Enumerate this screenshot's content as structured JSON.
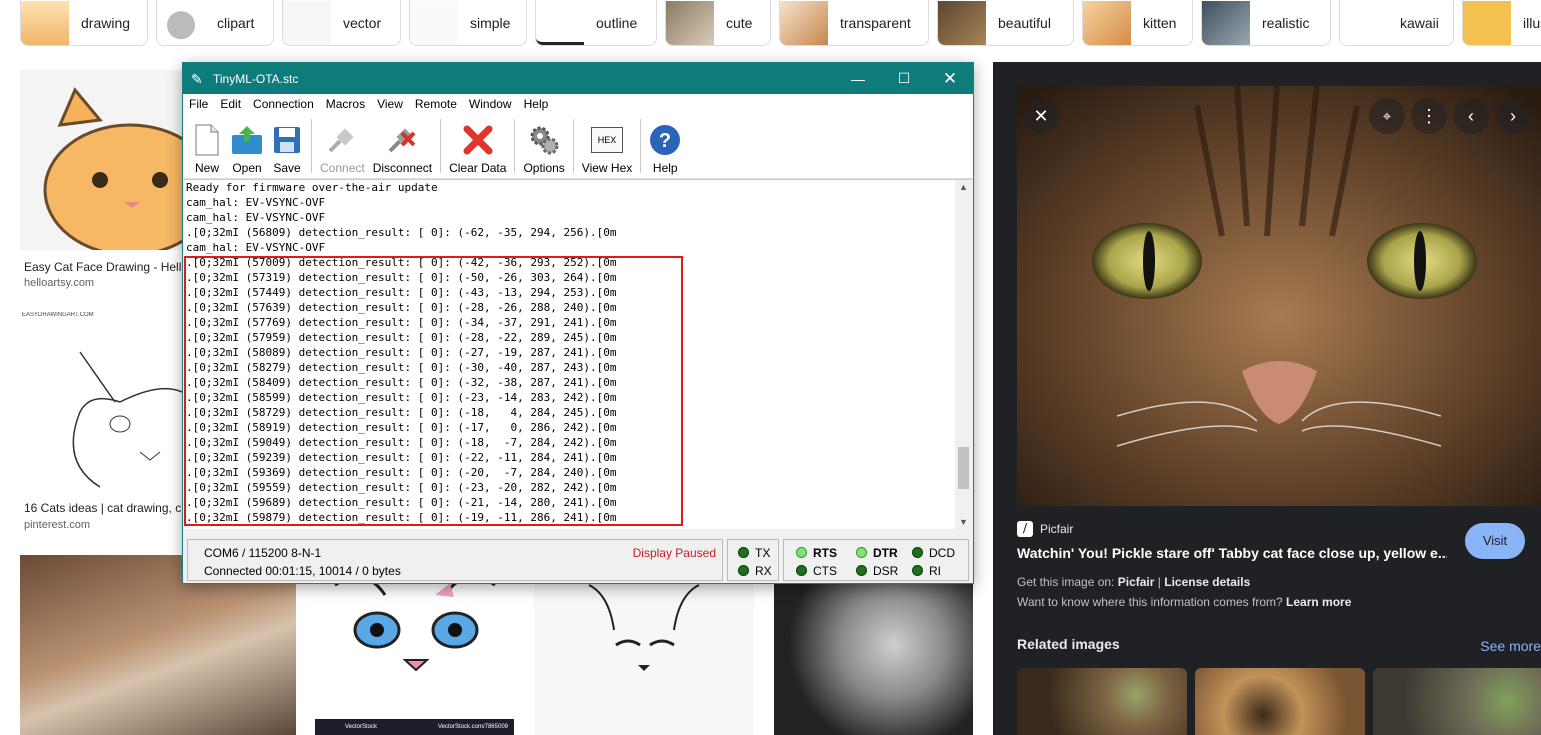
{
  "chips": [
    {
      "label": "drawing"
    },
    {
      "label": "clipart"
    },
    {
      "label": "vector"
    },
    {
      "label": "simple"
    },
    {
      "label": "outline"
    },
    {
      "label": "cute"
    },
    {
      "label": "transparent"
    },
    {
      "label": "beautiful"
    },
    {
      "label": "kitten"
    },
    {
      "label": "realistic"
    },
    {
      "label": "kawaii"
    },
    {
      "label": "illus"
    }
  ],
  "results": {
    "r1": {
      "title": "Easy Cat Face Drawing - Hell",
      "source": "helloartsy.com"
    },
    "r2": {
      "watermark": "EASYDRAWINGART.COM",
      "title": "16 Cats ideas | cat drawing, c",
      "source": "pinterest.com"
    },
    "r3_watermark": "VectorStock",
    "r3_watermark2": "VectorStock.com/7865009"
  },
  "window": {
    "title": "TinyML-OTA.stc",
    "menu": [
      "File",
      "Edit",
      "Connection",
      "Macros",
      "View",
      "Remote",
      "Window",
      "Help"
    ],
    "toolbar": {
      "new": "New",
      "open": "Open",
      "save": "Save",
      "connect": "Connect",
      "disconnect": "Disconnect",
      "clear": "Clear Data",
      "options": "Options",
      "viewhex": "View Hex",
      "hex_icon_text": "HEX",
      "help": "Help"
    },
    "terminal_lines": [
      "Ready for firmware over-the-air update",
      "cam_hal: EV-VSYNC-OVF",
      "cam_hal: EV-VSYNC-OVF",
      ".[0;32mI (56809) detection_result: [ 0]: (-62, -35, 294, 256).[0m",
      "cam_hal: EV-VSYNC-OVF",
      ".[0;32mI (57009) detection_result: [ 0]: (-42, -36, 293, 252).[0m",
      ".[0;32mI (57319) detection_result: [ 0]: (-50, -26, 303, 264).[0m",
      ".[0;32mI (57449) detection_result: [ 0]: (-43, -13, 294, 253).[0m",
      ".[0;32mI (57639) detection_result: [ 0]: (-28, -26, 288, 240).[0m",
      ".[0;32mI (57769) detection_result: [ 0]: (-34, -37, 291, 241).[0m",
      ".[0;32mI (57959) detection_result: [ 0]: (-28, -22, 289, 245).[0m",
      ".[0;32mI (58089) detection_result: [ 0]: (-27, -19, 287, 241).[0m",
      ".[0;32mI (58279) detection_result: [ 0]: (-30, -40, 287, 243).[0m",
      ".[0;32mI (58409) detection_result: [ 0]: (-32, -38, 287, 241).[0m",
      ".[0;32mI (58599) detection_result: [ 0]: (-23, -14, 283, 242).[0m",
      ".[0;32mI (58729) detection_result: [ 0]: (-18,   4, 284, 245).[0m",
      ".[0;32mI (58919) detection_result: [ 0]: (-17,   0, 286, 242).[0m",
      ".[0;32mI (59049) detection_result: [ 0]: (-18,  -7, 284, 242).[0m",
      ".[0;32mI (59239) detection_result: [ 0]: (-22, -11, 284, 241).[0m",
      ".[0;32mI (59369) detection_result: [ 0]: (-20,  -7, 284, 240).[0m",
      ".[0;32mI (59559) detection_result: [ 0]: (-23, -20, 282, 242).[0m",
      ".[0;32mI (59689) detection_result: [ 0]: (-21, -14, 280, 241).[0m",
      ".[0;32mI (59879) detection_result: [ 0]: (-19, -11, 286, 241).[0m"
    ],
    "status": {
      "port": "COM6 / 115200 8-N-1",
      "connected": "Connected 00:01:15, 10014 / 0 bytes",
      "paused": "Display Paused",
      "tx": "TX",
      "rx": "RX",
      "rts": "RTS",
      "cts": "CTS",
      "dtr": "DTR",
      "dsr": "DSR",
      "dcd": "DCD",
      "ri": "RI"
    },
    "accent": "#0e7c7b"
  },
  "panel": {
    "site": "Picfair",
    "title": "Watchin' You! Pickle stare off' Tabby cat face close up, yellow e...",
    "visit": "Visit",
    "get_prefix": "Get this image on:",
    "get_site": "Picfair",
    "separator": "|",
    "license": "License details",
    "info_q": "Want to know where this information comes from?",
    "learn_more": "Learn more",
    "related": "Related images",
    "see_more": "See more"
  }
}
